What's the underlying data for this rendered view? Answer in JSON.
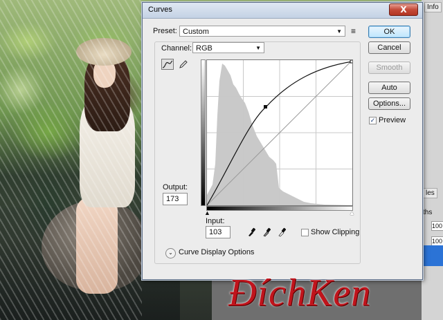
{
  "background_tabs": {
    "info_label": "Info",
    "layers_partial": "les",
    "paths_partial": "ths",
    "opacity_partial": "100",
    "fill_partial": "100"
  },
  "dialog": {
    "title": "Curves",
    "close_symbol": "X",
    "preset_label": "Preset:",
    "preset_value": "Custom",
    "channel_label": "Channel:",
    "channel_value": "RGB",
    "output_label": "Output:",
    "output_value": "173",
    "input_label": "Input:",
    "input_value": "103",
    "show_clipping_label": "Show Clipping",
    "show_clipping_checked": false,
    "curve_display_options_label": "Curve Display Options",
    "buttons": {
      "ok": "OK",
      "cancel": "Cancel",
      "smooth": "Smooth",
      "auto": "Auto",
      "options": "Options..."
    },
    "preview_label": "Preview",
    "preview_checked": true
  },
  "curve": {
    "point_input": 103,
    "point_output": 173
  },
  "watermark_text": "ĐíchKen",
  "icons": {
    "preset_menu": "list-menu-icon",
    "curve_tool": "curve-point-tool-icon",
    "pencil_tool": "pencil-tool-icon",
    "black_eyedropper": "black-point-eyedropper-icon",
    "gray_eyedropper": "gray-point-eyedropper-icon",
    "white_eyedropper": "white-point-eyedropper-icon",
    "expander": "chevron-expand-icon"
  },
  "colors": {
    "accent": "#3c7fb1",
    "close_button": "#c44a38",
    "watermark": "#c0141c",
    "selection_strip": "#2b73d6"
  }
}
